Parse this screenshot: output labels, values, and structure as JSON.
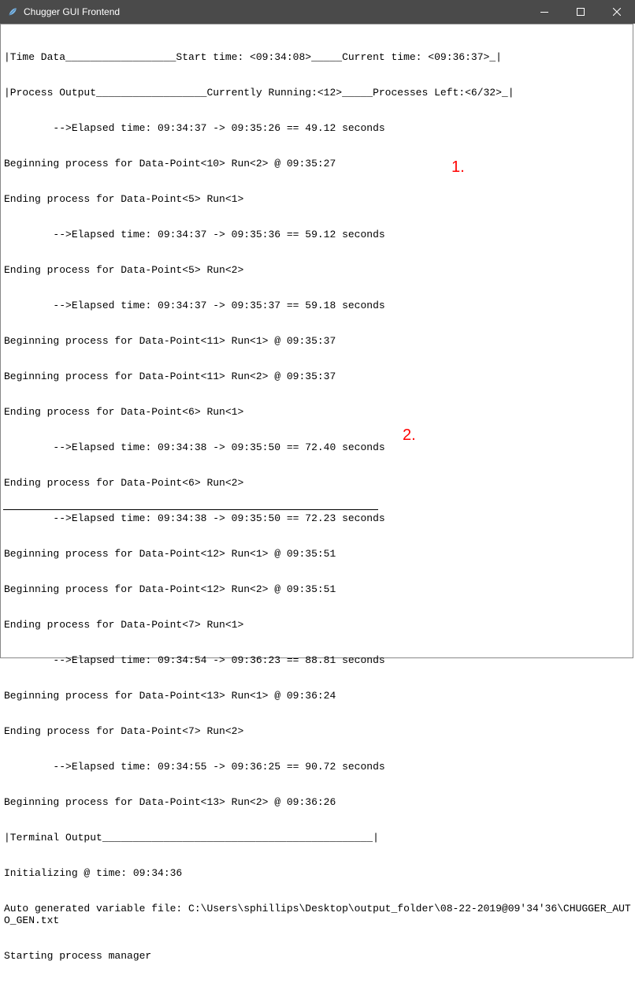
{
  "titlebar": {
    "title": "Chugger GUI Frontend"
  },
  "time_data_header": "|Time Data__________________Start time: <09:34:08>_____Current time: <09:36:37>_|",
  "process_output_header": "|Process Output__________________Currently Running:<12>_____Processes Left:<6/32>_|",
  "log": [
    "        -->Elapsed time: 09:34:37 -> 09:35:26 == 49.12 seconds",
    "Beginning process for Data-Point<10> Run<2> @ 09:35:27",
    "Ending process for Data-Point<5> Run<1>",
    "        -->Elapsed time: 09:34:37 -> 09:35:36 == 59.12 seconds",
    "Ending process for Data-Point<5> Run<2>",
    "        -->Elapsed time: 09:34:37 -> 09:35:37 == 59.18 seconds",
    "Beginning process for Data-Point<11> Run<1> @ 09:35:37",
    "Beginning process for Data-Point<11> Run<2> @ 09:35:37",
    "Ending process for Data-Point<6> Run<1>",
    "        -->Elapsed time: 09:34:38 -> 09:35:50 == 72.40 seconds",
    "Ending process for Data-Point<6> Run<2>",
    "        -->Elapsed time: 09:34:38 -> 09:35:50 == 72.23 seconds",
    "Beginning process for Data-Point<12> Run<1> @ 09:35:51",
    "Beginning process for Data-Point<12> Run<2> @ 09:35:51",
    "Ending process for Data-Point<7> Run<1>",
    "        -->Elapsed time: 09:34:54 -> 09:36:23 == 88.81 seconds",
    "Beginning process for Data-Point<13> Run<1> @ 09:36:24",
    "Ending process for Data-Point<7> Run<2>",
    "        -->Elapsed time: 09:34:55 -> 09:36:25 == 90.72 seconds",
    "Beginning process for Data-Point<13> Run<2> @ 09:36:26"
  ],
  "terminal_output_header": "|Terminal Output____________________________________________|",
  "terminal_lines": [
    "Initializing @ time: 09:34:36",
    "Auto generated variable file: C:\\Users\\sphillips\\Desktop\\output_folder\\08-22-2019@09'34'36\\CHUGGER_AUTO_GEN.txt",
    "Starting process manager"
  ],
  "annotations": {
    "a1": "1.",
    "a2": "2."
  }
}
